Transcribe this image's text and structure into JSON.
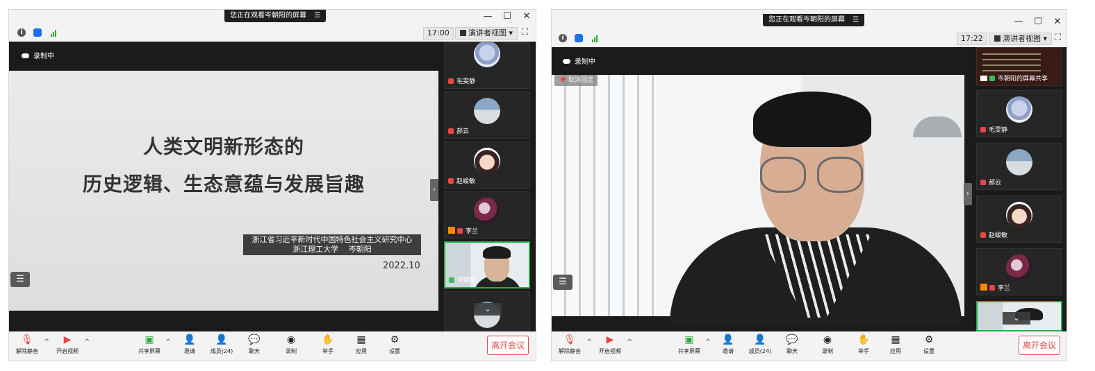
{
  "banner": {
    "text": "您正在观看岑朝阳的屏幕",
    "menu_icon": "≡"
  },
  "window_controls": {
    "minimize": "—",
    "maximize": "☐",
    "close": "✕"
  },
  "left_window": {
    "clock": "17:00",
    "view_label": "演讲者视图",
    "view_caret": "▾",
    "recording": "录制中",
    "slide": {
      "title_line1": "人类文明新形态的",
      "title_line2": "历史逻辑、生态意蕴与发展旨趣",
      "org_line1": "浙江省习近平新时代中国特色社会主义研究中心",
      "org_line2": "浙江理工大学　 岑朝阳",
      "date": "2022.10"
    },
    "participants": [
      "毛雯静",
      "郝云",
      "赵峻敏",
      "李兰",
      "岑朝阳"
    ]
  },
  "right_window": {
    "clock": "17:22",
    "view_label": "演讲者视图",
    "view_caret": "▾",
    "recording": "录制中",
    "cancel_pin": "取消固定",
    "share_label": "岑朝阳的屏幕共享",
    "participants": [
      "毛雯静",
      "郝云",
      "赵峻敏",
      "李兰"
    ]
  },
  "toolbar": {
    "unmute": "解除静音",
    "start_video": "开启视频",
    "share_screen": "共享屏幕",
    "invite": "邀请",
    "members": "成员(24)",
    "chat": "聊天",
    "record": "录制",
    "raise_hand": "举手",
    "apps": "应用",
    "settings": "设置",
    "leave": "离开会议"
  },
  "icons": {
    "list": "☰",
    "collapse_right": "›",
    "scroll_down": "⌄"
  },
  "colors": {
    "leave": "#e04a4a",
    "active_border": "#22b14c",
    "muted_mic": "#e84545",
    "host_badge": "#ff8a00"
  }
}
